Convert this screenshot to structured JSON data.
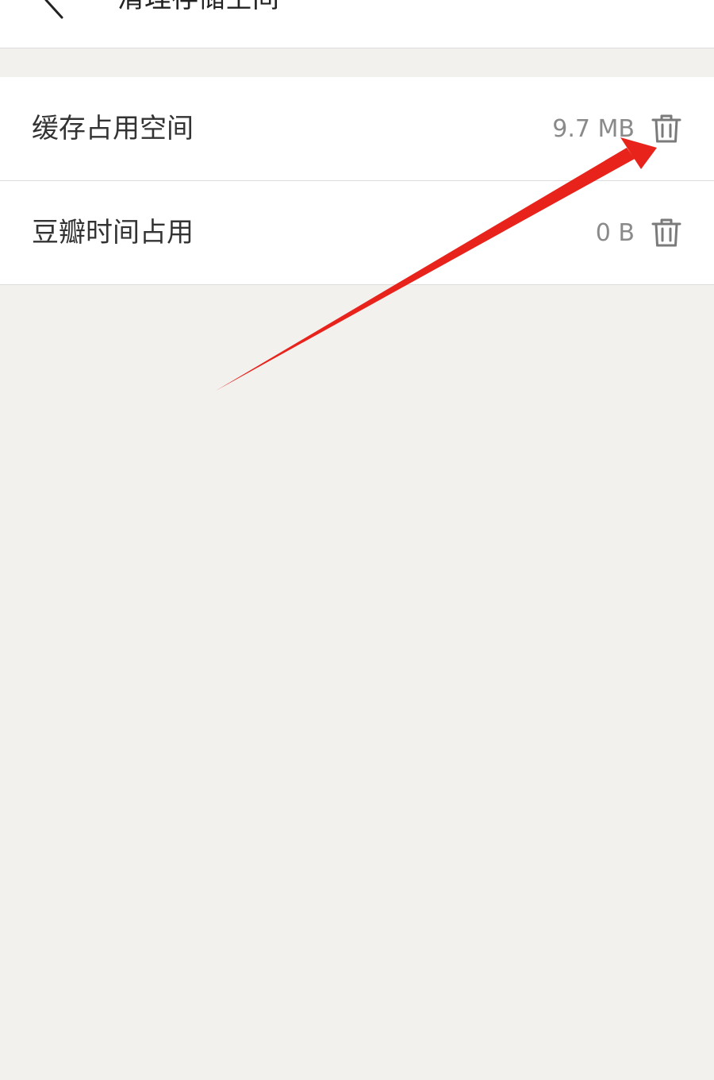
{
  "header": {
    "title": "清理存储空间",
    "back_icon": "chevron-left-icon"
  },
  "storage_items": [
    {
      "label": "缓存占用空间",
      "value": "9.7 MB",
      "action_icon": "trash-icon"
    },
    {
      "label": "豆瓣时间占用",
      "value": "0 B",
      "action_icon": "trash-icon"
    }
  ],
  "colors": {
    "background": "#f2f1ee",
    "surface": "#ffffff",
    "divider": "#dcdcdc",
    "primary_text": "#333333",
    "secondary_text": "#8a8a8a",
    "icon": "#7a7a7a",
    "annotation_arrow": "#e8231c"
  }
}
